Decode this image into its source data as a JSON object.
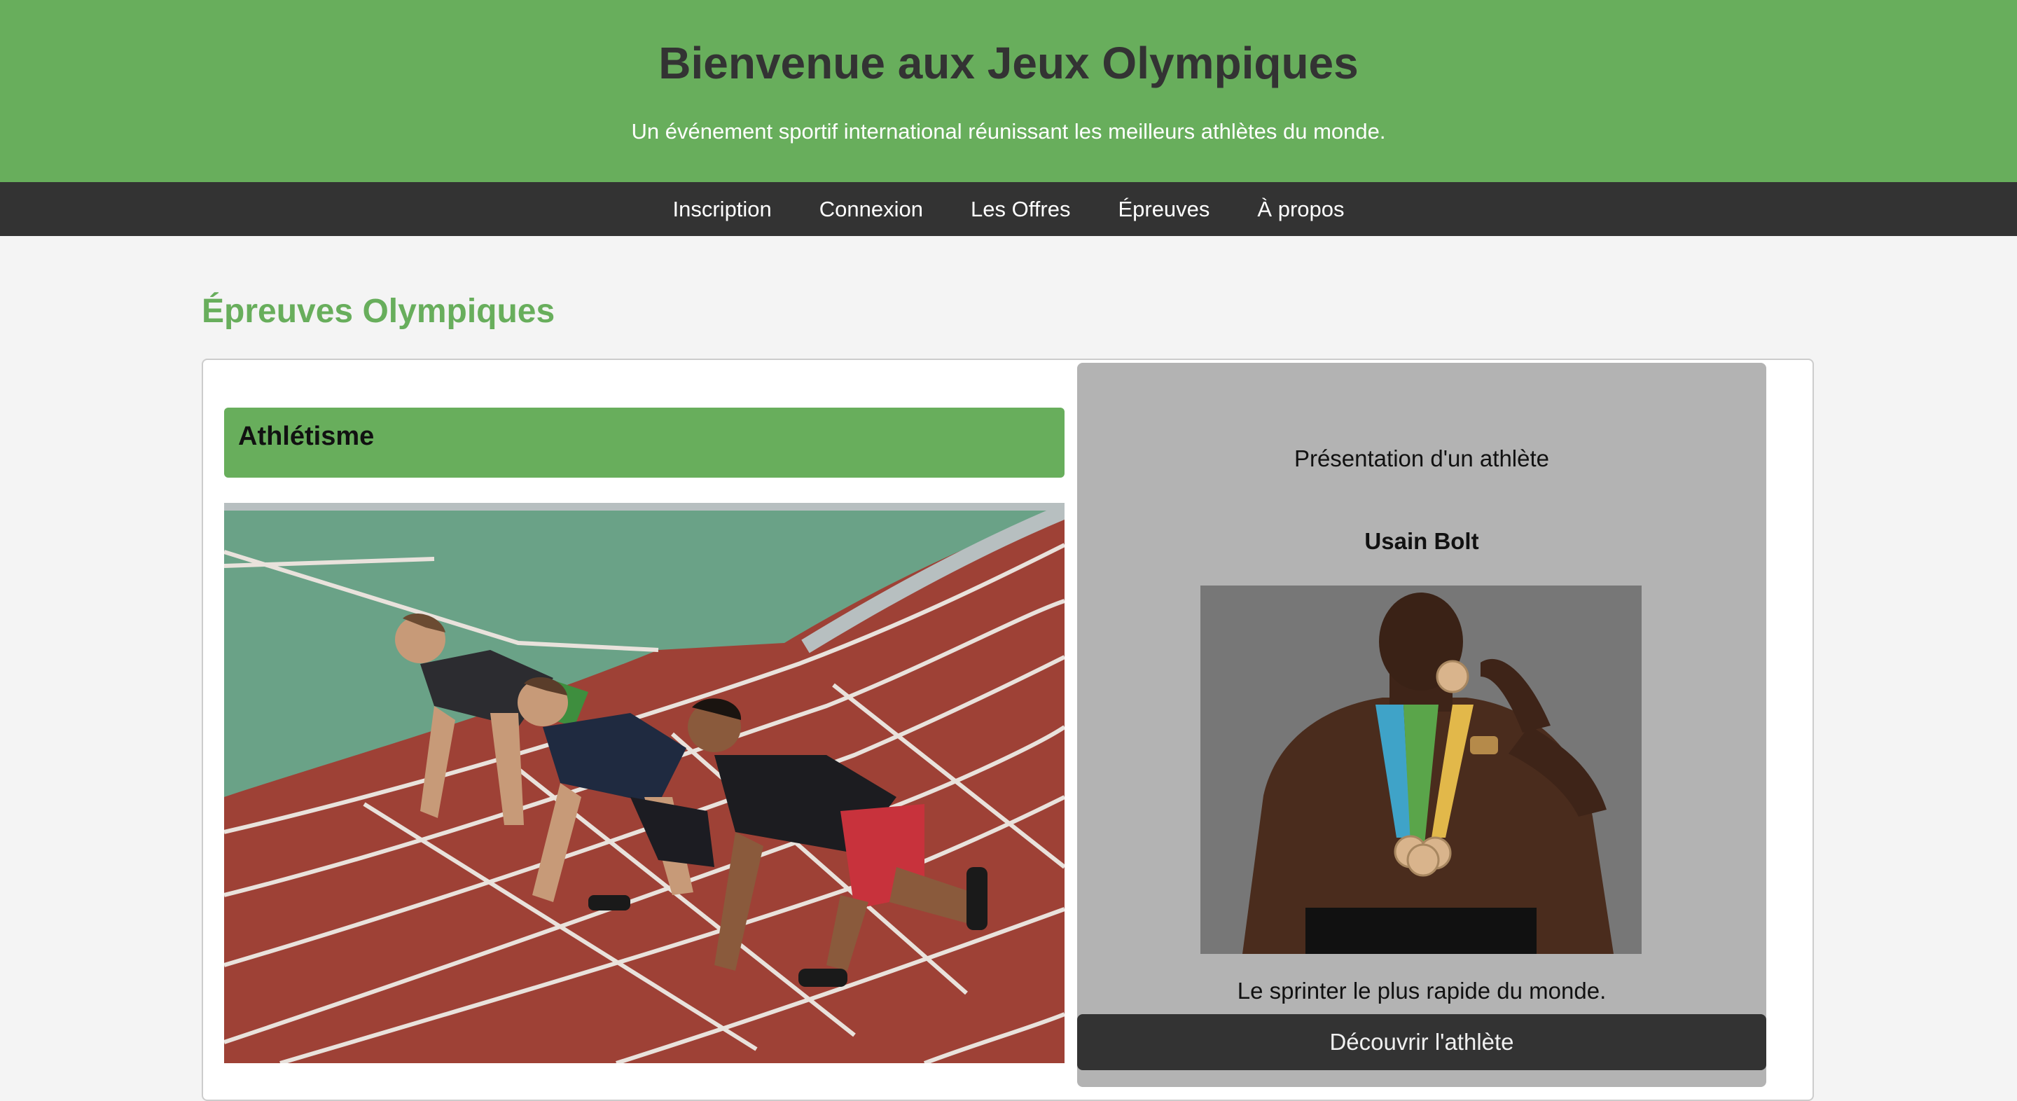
{
  "header": {
    "title": "Bienvenue aux Jeux Olympiques",
    "subtitle": "Un événement sportif international réunissant les meilleurs athlètes du monde."
  },
  "nav": {
    "items": [
      {
        "label": "Inscription"
      },
      {
        "label": "Connexion"
      },
      {
        "label": "Les Offres"
      },
      {
        "label": "Épreuves"
      },
      {
        "label": "À propos"
      }
    ]
  },
  "main": {
    "section_title": "Épreuves Olympiques",
    "event": {
      "title": "Athlétisme",
      "image_icon": "sprinters-at-starting-line-photo"
    },
    "athlete_card": {
      "heading": "Présentation d'un athlète",
      "name": "Usain Bolt",
      "photo_icon": "athlete-with-medals-photo",
      "description": "Le sprinter le plus rapide du monde.",
      "button_label": "Découvrir l'athlète"
    }
  },
  "colors": {
    "brand_green": "#68ae5c",
    "dark": "#333333",
    "card_gray": "#b3b3b3",
    "page_bg": "#f4f4f4"
  }
}
